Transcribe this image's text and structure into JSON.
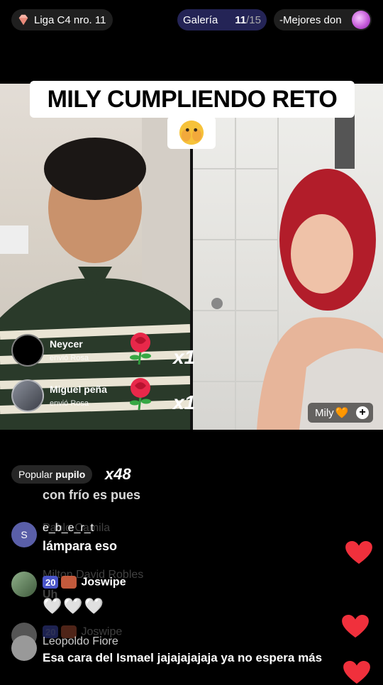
{
  "top": {
    "league": "Liga C4 nro. 11",
    "gallery_label": "Galería",
    "gallery_current": "11",
    "gallery_total": "/15",
    "best": "-Mejores don"
  },
  "title": {
    "text": "MILY CUMPLIENDO RETO",
    "emoji": "😱"
  },
  "gifts": [
    {
      "name": "Neycer",
      "sub": "envió Rosa",
      "mult": "x1"
    },
    {
      "name": "Miguel peña",
      "sub": "envió Rosa",
      "mult": "x1"
    }
  ],
  "streamer_tag": {
    "name": "Mily",
    "emoji": "🧡",
    "plus": "+"
  },
  "popular": {
    "label": "Popular",
    "name": "pupilo",
    "mult": "x48"
  },
  "comments": [
    {
      "text": "con frío es pues"
    },
    {
      "ghost_user": "Pablo Camila",
      "user": "e_b_e_r_t",
      "avatar_letter": "S",
      "text": "lámpara eso"
    },
    {
      "ghost_user": "Milton David Robles",
      "level": "20",
      "user": "Joswipe",
      "text": "Uh",
      "hearts": "🤍🤍🤍"
    },
    {
      "level": "20",
      "user": "Joswipe"
    },
    {
      "user": "Leopoldo Fiore",
      "text": "Esa cara del Ismael jajajajajaja ya no espera más"
    }
  ],
  "colors": {
    "heart": "#f0303c",
    "gallery_bg": "#242456",
    "badge": "#4a55c8"
  }
}
